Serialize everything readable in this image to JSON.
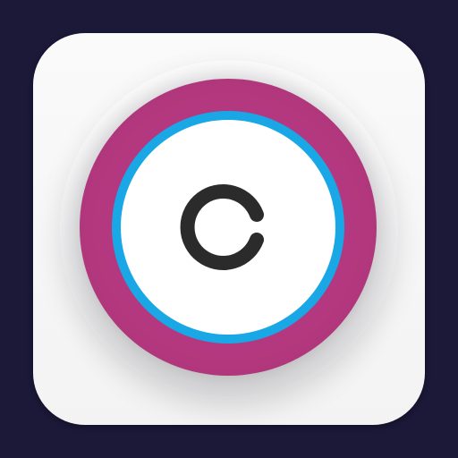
{
  "icon": {
    "name": "app-icon",
    "letter": "C",
    "colors": {
      "background": "#1b1838",
      "tile": "#f5f5f6",
      "outer_ring": "#b4387f",
      "inner_ring": "#1aa7e6",
      "core": "#ffffff",
      "letter": "#2b2b2b"
    }
  }
}
